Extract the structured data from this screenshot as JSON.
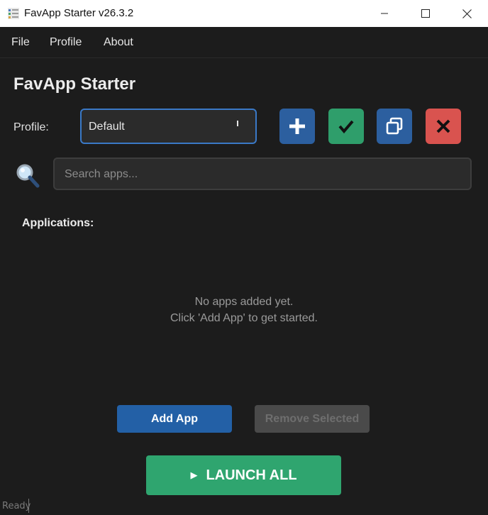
{
  "window": {
    "title": "FavApp Starter v26.3.2"
  },
  "menu": {
    "items": [
      "File",
      "Profile",
      "About"
    ]
  },
  "header": {
    "title": "FavApp Starter"
  },
  "profile": {
    "label": "Profile:",
    "selected": "Default"
  },
  "toolbar": {
    "add_icon": "plus-icon",
    "save_icon": "check-icon",
    "duplicate_icon": "copy-icon",
    "delete_icon": "x-icon",
    "colors": {
      "add": "#2c5f9f",
      "save": "#2f9e6b",
      "duplicate": "#2c5f9f",
      "delete": "#d9534f"
    }
  },
  "search": {
    "placeholder": "Search apps..."
  },
  "apps": {
    "label": "Applications:",
    "empty_line1": "No apps added yet.",
    "empty_line2": "Click 'Add App' to get started."
  },
  "actions": {
    "add_label": "Add App",
    "remove_label": "Remove Selected",
    "launch_label": "LAUNCH ALL",
    "launch_icon": "play-triangle-icon"
  },
  "status": {
    "text": "Ready"
  }
}
